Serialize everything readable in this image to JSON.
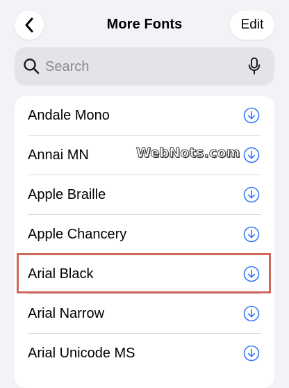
{
  "header": {
    "title": "More Fonts",
    "back_icon": "chevron-left-icon",
    "edit_label": "Edit"
  },
  "search": {
    "placeholder": "Search",
    "value": "",
    "search_icon": "magnifying-glass-icon",
    "mic_icon": "microphone-icon"
  },
  "fonts": [
    {
      "name": "Andale Mono",
      "action_icon": "download-icon"
    },
    {
      "name": "Annai MN",
      "action_icon": "download-icon"
    },
    {
      "name": "Apple Braille",
      "action_icon": "download-icon"
    },
    {
      "name": "Apple Chancery",
      "action_icon": "download-icon"
    },
    {
      "name": "Arial Black",
      "action_icon": "download-icon",
      "highlighted": true
    },
    {
      "name": "Arial Narrow",
      "action_icon": "download-icon"
    },
    {
      "name": "Arial Unicode MS",
      "action_icon": "download-icon"
    }
  ],
  "watermark": {
    "text": "WebNots.com"
  },
  "colors": {
    "background": "#f2f2f7",
    "accent": "#3478f6",
    "highlight_border": "#d0685d"
  }
}
